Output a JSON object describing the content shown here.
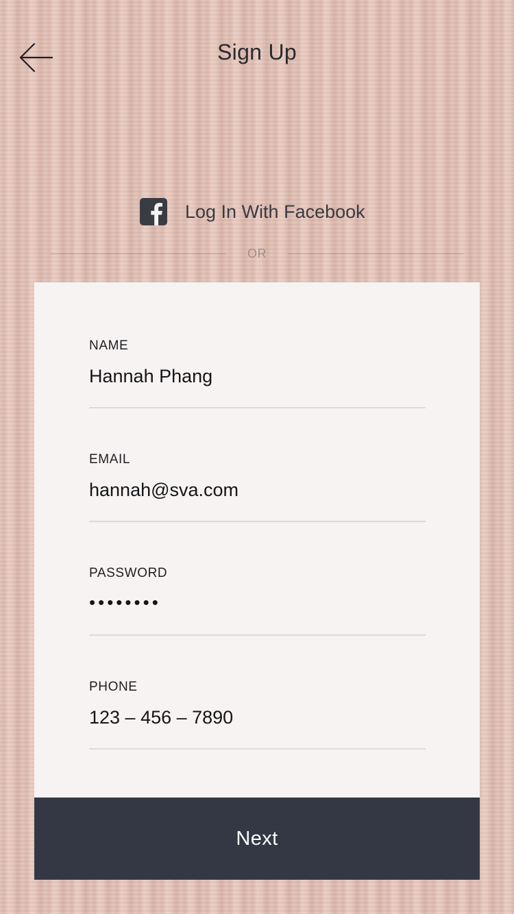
{
  "header": {
    "title": "Sign Up",
    "back_icon": "arrow-left-icon"
  },
  "facebook": {
    "label": "Log In With Facebook",
    "icon": "facebook-icon"
  },
  "divider": {
    "text": "OR"
  },
  "form": {
    "fields": [
      {
        "label": "NAME",
        "value": "Hannah Phang"
      },
      {
        "label": "EMAIL",
        "value": "hannah@sva.com"
      },
      {
        "label": "PASSWORD",
        "value": "••••••••"
      },
      {
        "label": "PHONE",
        "value": "123 – 456 – 7890"
      }
    ],
    "submit_label": "Next"
  },
  "colors": {
    "background": "#e3c3b8",
    "card": "#f6f3f2",
    "button": "#333844",
    "button_text": "#ffffff"
  }
}
